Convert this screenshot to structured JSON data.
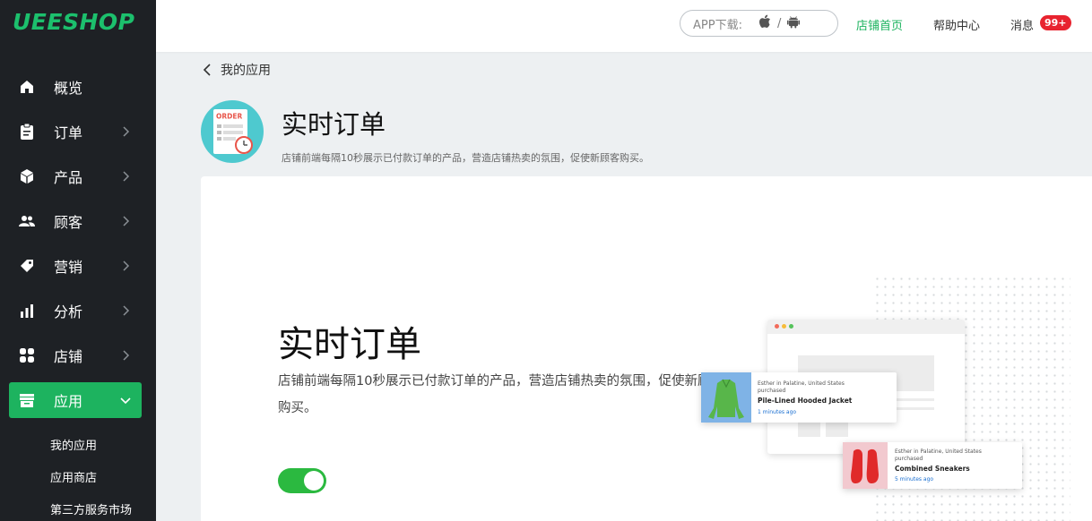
{
  "brand": {
    "logo_text": "UEESHOP",
    "accent": "#1db35f"
  },
  "sidebar": {
    "items": [
      {
        "label": "概览",
        "icon": "home-icon"
      },
      {
        "label": "订单",
        "icon": "clipboard-icon"
      },
      {
        "label": "产品",
        "icon": "cube-icon"
      },
      {
        "label": "顾客",
        "icon": "users-icon"
      },
      {
        "label": "营销",
        "icon": "tag-icon"
      },
      {
        "label": "分析",
        "icon": "bar-chart-icon"
      },
      {
        "label": "店铺",
        "icon": "grid-icon"
      },
      {
        "label": "应用",
        "icon": "store-icon"
      }
    ],
    "sub_items": [
      {
        "label": "我的应用"
      },
      {
        "label": "应用商店"
      },
      {
        "label": "第三方服务市场"
      }
    ]
  },
  "topbar": {
    "app_download": "APP下载:",
    "separator": "/",
    "store_home": "店铺首页",
    "help_center": "帮助中心",
    "messages": "消息",
    "message_badge": "99+"
  },
  "header": {
    "back_label": "我的应用",
    "app_name": "实时订单",
    "app_description": "店铺前端每隔10秒展示已付款订单的产品，营造店铺热卖的氛围，促使新顾客购买。",
    "icon_label": "ORDER"
  },
  "card": {
    "title": "实时订单",
    "description": "店铺前端每隔10秒展示已付款订单的产品，营造店铺热卖的氛围，促使新顾客购买。",
    "toggle_on": true
  },
  "preview": {
    "notif1": {
      "line1": "Esther in Palatine, United States",
      "line2": "purchased",
      "product": "Pile-Lined Hooded Jacket",
      "time": "1 minutes ago"
    },
    "notif2": {
      "line1": "Esther in Palatine, United States",
      "line2": "purchased",
      "product": "Combined Sneakers",
      "time": "5 minutes ago"
    }
  }
}
